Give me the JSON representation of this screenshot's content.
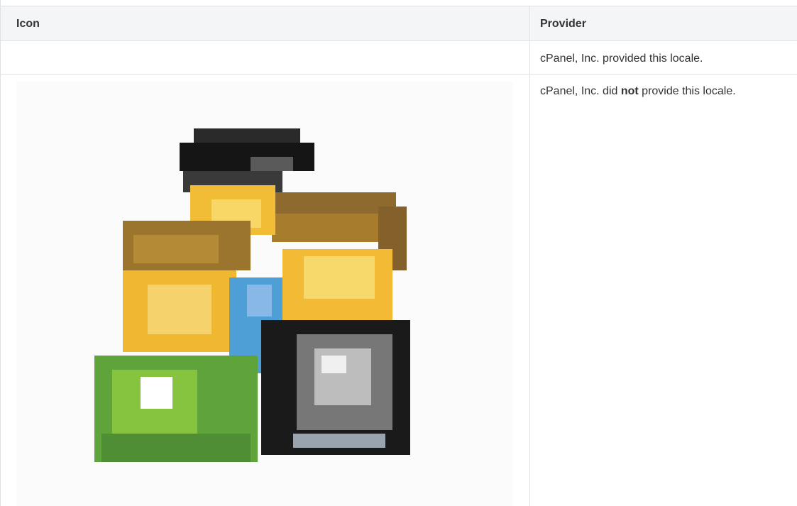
{
  "table": {
    "headers": {
      "icon": "Icon",
      "provider": "Provider"
    },
    "rows": [
      {
        "provider_text": "cPanel, Inc. provided this locale."
      },
      {
        "provider_prefix": "cPanel, Inc. did ",
        "provider_emphasis": "not",
        "provider_suffix": " provide this locale.",
        "icon_name": "locale-languages-icon"
      }
    ]
  },
  "colors": {
    "header_background": "#f4f5f7",
    "border": "#dfe1e5",
    "text": "#333333"
  }
}
